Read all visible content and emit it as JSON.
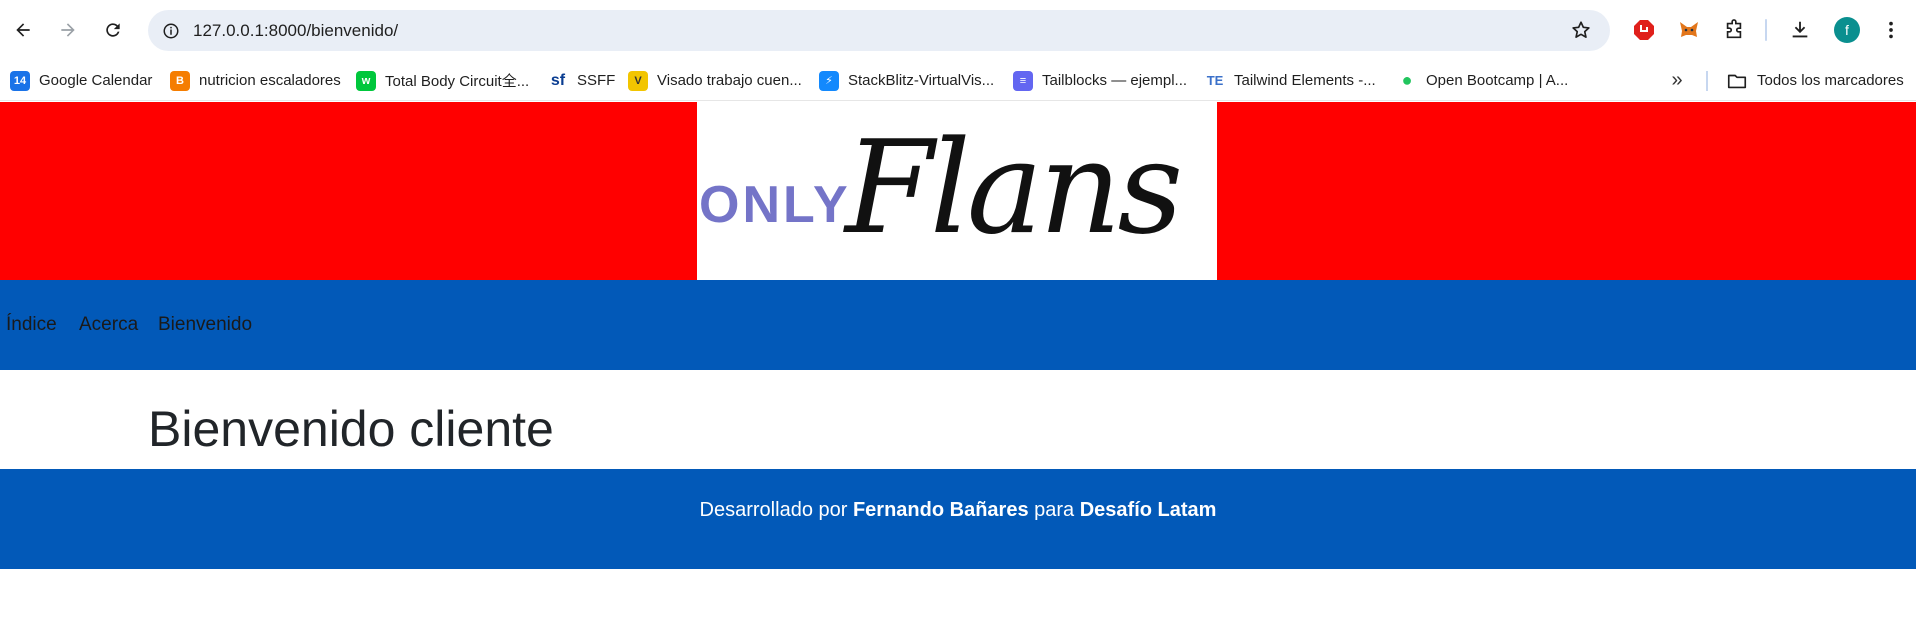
{
  "browser": {
    "url": "127.0.0.1:8000/bienvenido/",
    "avatar_letter": "f",
    "bookmarks": [
      {
        "label": "Google Calendar",
        "icon": "calendar-icon",
        "color": "#1a73e8",
        "glyph": "14"
      },
      {
        "label": "nutricion escaladores",
        "icon": "blogger-icon",
        "color": "#f57d00",
        "glyph": "B"
      },
      {
        "label": "Total Body Circuit全...",
        "icon": "webtoon-icon",
        "color": "#00c73c",
        "glyph": "w"
      },
      {
        "label": "SSFF",
        "icon": "sf-icon",
        "color": "#0a3d91",
        "glyph": "sf"
      },
      {
        "label": "Visado trabajo cuen...",
        "icon": "visa-icon",
        "color": "#f2c500",
        "glyph": "V"
      },
      {
        "label": "StackBlitz-VirtualVis...",
        "icon": "stackblitz-icon",
        "color": "#1389fd",
        "glyph": "⚡"
      },
      {
        "label": "Tailblocks — ejempl...",
        "icon": "tailblocks-icon",
        "color": "#6366f1",
        "glyph": "≡"
      },
      {
        "label": "Tailwind Elements -...",
        "icon": "tailwind-elements-icon",
        "color": "#3b71ca",
        "glyph": "TE"
      },
      {
        "label": "Open Bootcamp | A...",
        "icon": "open-bootcamp-icon",
        "color": "#22c55e",
        "glyph": "●"
      }
    ],
    "all_bookmarks_label": "Todos los marcadores"
  },
  "colors": {
    "hero_bg": "#ff0000",
    "nav_bg": "#0259b8",
    "footer_bg": "#0259b8"
  },
  "logo": {
    "prefix": "ONLY",
    "script": "Flans"
  },
  "nav": {
    "links": [
      "Índice",
      "Acerca",
      "Bienvenido"
    ]
  },
  "main": {
    "title": "Bienvenido cliente"
  },
  "footer": {
    "text_before": "Desarrollado por",
    "author": "Fernando Bañares",
    "text_middle": "para",
    "org": "Desafío Latam"
  }
}
